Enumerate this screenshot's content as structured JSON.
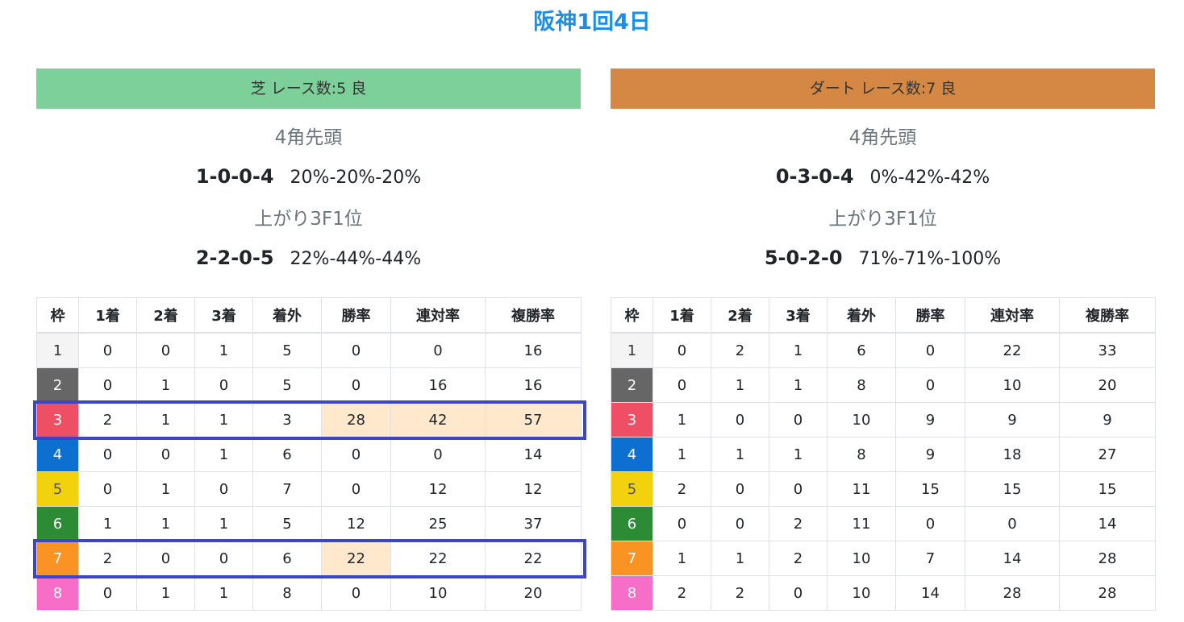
{
  "title": "阪神1回4日",
  "colors": {
    "title": "#1a8ee8",
    "turf_header": "#7dd099",
    "dirt_header": "#d48843",
    "highlight_cell": "#ffe8cc",
    "highlight_box": "#3d45c2",
    "waku": {
      "1": "#f4f4f4",
      "2": "#666666",
      "3": "#ef4f64",
      "4": "#0d6fd0",
      "5": "#f2d20d",
      "6": "#2e8b35",
      "7": "#f99322",
      "8": "#f76ec9"
    }
  },
  "columns": [
    "枠",
    "1着",
    "2着",
    "3着",
    "着外",
    "勝率",
    "連対率",
    "複勝率"
  ],
  "panels": [
    {
      "id": "turf",
      "header": "芝 レース数:5  良",
      "leader_heading": "4角先頭",
      "leader_record": "1-0-0-4",
      "leader_rates": "20%-20%-20%",
      "last3f_heading": "上がり3F1位",
      "last3f_record": "2-2-0-5",
      "last3f_rates": "22%-44%-44%",
      "rows": [
        [
          "1",
          "0",
          "0",
          "1",
          "5",
          "0",
          "0",
          "16"
        ],
        [
          "2",
          "0",
          "1",
          "0",
          "5",
          "0",
          "16",
          "16"
        ],
        [
          "3",
          "2",
          "1",
          "1",
          "3",
          "28",
          "42",
          "57"
        ],
        [
          "4",
          "0",
          "0",
          "1",
          "6",
          "0",
          "0",
          "14"
        ],
        [
          "5",
          "0",
          "1",
          "0",
          "7",
          "0",
          "12",
          "12"
        ],
        [
          "6",
          "1",
          "1",
          "1",
          "5",
          "12",
          "25",
          "37"
        ],
        [
          "7",
          "2",
          "0",
          "0",
          "6",
          "22",
          "22",
          "22"
        ],
        [
          "8",
          "0",
          "1",
          "1",
          "8",
          "0",
          "10",
          "20"
        ]
      ],
      "highlighted_cells": [
        [
          2,
          5
        ],
        [
          2,
          6
        ],
        [
          2,
          7
        ],
        [
          6,
          5
        ]
      ],
      "boxed_rows": [
        2,
        6
      ]
    },
    {
      "id": "dirt",
      "header": "ダート レース数:7  良",
      "leader_heading": "4角先頭",
      "leader_record": "0-3-0-4",
      "leader_rates": "0%-42%-42%",
      "last3f_heading": "上がり3F1位",
      "last3f_record": "5-0-2-0",
      "last3f_rates": "71%-71%-100%",
      "rows": [
        [
          "1",
          "0",
          "2",
          "1",
          "6",
          "0",
          "22",
          "33"
        ],
        [
          "2",
          "0",
          "1",
          "1",
          "8",
          "0",
          "10",
          "20"
        ],
        [
          "3",
          "1",
          "0",
          "0",
          "10",
          "9",
          "9",
          "9"
        ],
        [
          "4",
          "1",
          "1",
          "1",
          "8",
          "9",
          "18",
          "27"
        ],
        [
          "5",
          "2",
          "0",
          "0",
          "11",
          "15",
          "15",
          "15"
        ],
        [
          "6",
          "0",
          "0",
          "2",
          "11",
          "0",
          "0",
          "14"
        ],
        [
          "7",
          "1",
          "1",
          "2",
          "10",
          "7",
          "14",
          "28"
        ],
        [
          "8",
          "2",
          "2",
          "0",
          "10",
          "14",
          "28",
          "28"
        ]
      ],
      "highlighted_cells": [],
      "boxed_rows": []
    }
  ]
}
